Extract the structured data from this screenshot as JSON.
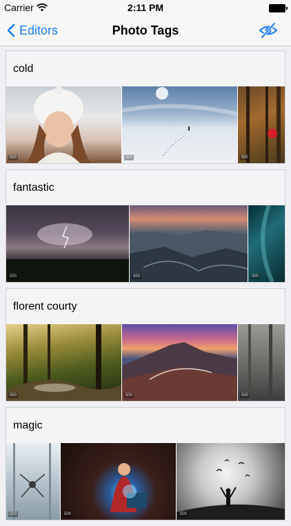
{
  "status_bar": {
    "carrier": "Carrier",
    "time": "2:11 PM"
  },
  "nav": {
    "back_label": "Editors",
    "title": "Photo Tags",
    "right_icon": "eye-slash-icon",
    "accent_color": "#1a7cf5"
  },
  "photo_credit": "500",
  "tags": [
    {
      "name": "cold"
    },
    {
      "name": "fantastic"
    },
    {
      "name": "florent courty"
    },
    {
      "name": "magic"
    }
  ]
}
